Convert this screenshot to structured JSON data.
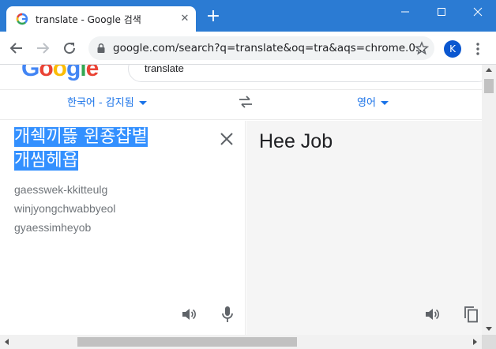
{
  "browser": {
    "tab_title": "translate - Google 검색",
    "tab_close_glyph": "✕",
    "new_tab_glyph": "+",
    "url": "google.com/search?q=translate&oq=tra&aqs=chrome.0...",
    "profile_initial": "K",
    "accent_color": "#2b7bd3"
  },
  "search": {
    "logo": [
      "G",
      "o",
      "o",
      "g",
      "l",
      "e"
    ],
    "logo_colors": [
      "#4285f4",
      "#ea4335",
      "#fbbc05",
      "#4285f4",
      "#34a853",
      "#ea4335"
    ],
    "query": "translate"
  },
  "translate": {
    "source_lang": "한국어 - 감지됨",
    "target_lang": "영어",
    "source_lines": [
      "개쉑끼뜷 윈죵챱볕",
      "개씸헤욥"
    ],
    "romanization": [
      "gaesswek-kkitteulg",
      "winjyongchwabbyeol",
      "gyaessimheyob"
    ],
    "translation": "Hee Job",
    "link_color": "#1a73e8",
    "selection_color": "#3390ff"
  },
  "icons": {
    "favicon": "google-favicon-icon",
    "back": "back-arrow-icon",
    "forward": "forward-arrow-icon",
    "reload": "reload-icon",
    "lock": "lock-icon",
    "star": "bookmark-star-icon",
    "menu": "kebab-menu-icon",
    "swap": "swap-languages-icon",
    "clear": "close-icon",
    "listen": "speaker-icon",
    "mic": "microphone-icon",
    "copy": "copy-icon"
  }
}
